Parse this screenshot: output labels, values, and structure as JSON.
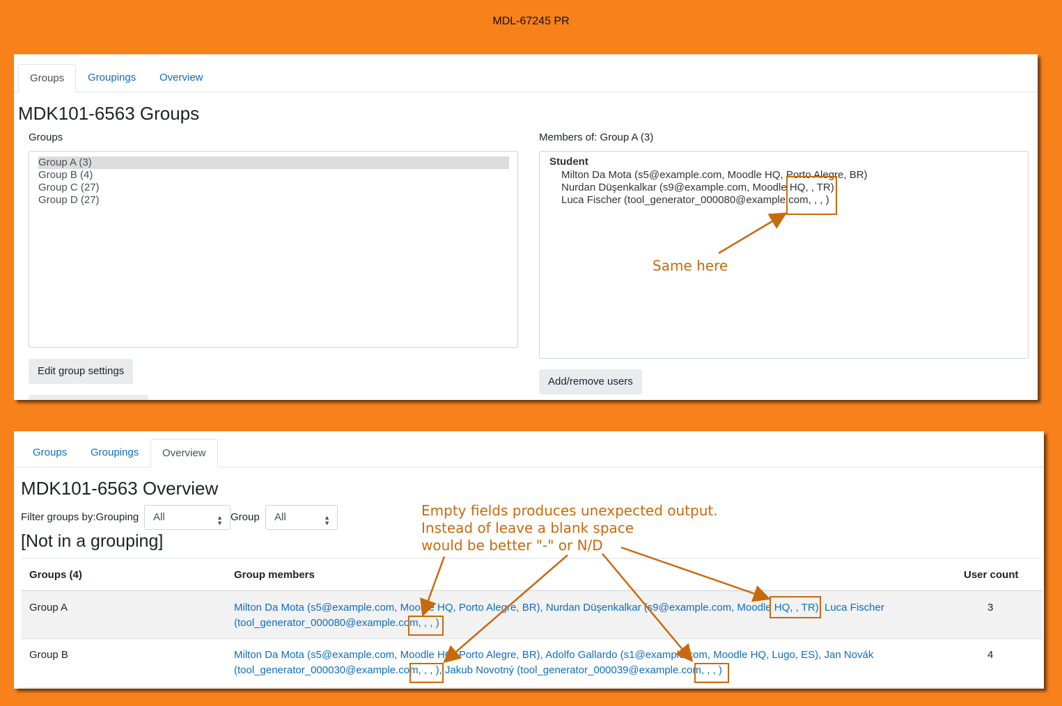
{
  "title": "MDL-67245 PR",
  "panel1": {
    "tabs": [
      "Groups",
      "Groupings",
      "Overview"
    ],
    "heading": "MDK101-6563 Groups",
    "groups_label": "Groups",
    "groups": [
      "Group A (3)",
      "Group B (4)",
      "Group C (27)",
      "Group D (27)"
    ],
    "members_label": "Members of: Group A (3)",
    "role": "Student",
    "members": [
      "Milton Da Mota (s5@example.com, Moodle HQ, Porto Alegre, BR)",
      "Nurdan Düşenkalkar (s9@example.com, Moodle HQ, , TR)",
      "Luca Fischer (tool_generator_000080@example.com, , , )"
    ],
    "edit_button": "Edit group settings",
    "add_remove_button": "Add/remove users",
    "annotation": "Same here"
  },
  "panel2": {
    "tabs": [
      "Groups",
      "Groupings",
      "Overview"
    ],
    "heading": "MDK101-6563 Overview",
    "filter_label": "Filter groups by:Grouping",
    "grouping_value": "All",
    "group_label": "Group",
    "group_value": "All",
    "subheading": "[Not in a grouping]",
    "table": {
      "headers": [
        "Groups (4)",
        "Group members",
        "User count"
      ],
      "rows": [
        {
          "group": "Group A",
          "line1": "Milton Da Mota (s5@example.com, Moodle HQ, Porto Alegre, BR), Nurdan Düşenkalkar (s9@example.com, Moodle HQ, , TR), Luca Fischer",
          "line2": "(tool_generator_000080@example.com, , , )",
          "count": "3"
        },
        {
          "group": "Group B",
          "line1": "Milton Da Mota (s5@example.com, Moodle HQ, Porto Alegre, BR), Adolfo Gallardo (s1@example.com, Moodle HQ, Lugo, ES), Jan Novák",
          "line2": "(tool_generator_000030@example.com, , , ), Jakub Novotný (tool_generator_000039@example.com, , , )",
          "count": "4"
        }
      ]
    },
    "annotation": "Empty fields produces unexpected output.\nInstead of leave a blank space\nwould be better \"-\" or N/D"
  },
  "colors": {
    "background": "#f7811a",
    "annotation": "#c8690c",
    "link": "#0f6cbf"
  }
}
